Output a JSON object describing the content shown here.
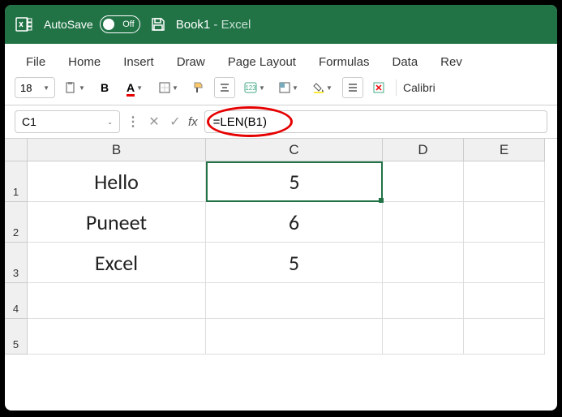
{
  "titlebar": {
    "autosave_label": "AutoSave",
    "autosave_state": "Off",
    "doc_name": "Book1",
    "app_suffix": " -  Excel"
  },
  "tabs": [
    "File",
    "Home",
    "Insert",
    "Draw",
    "Page Layout",
    "Formulas",
    "Data",
    "Rev"
  ],
  "toolbar": {
    "font_size": "18",
    "font_name": "Calibri"
  },
  "formula_bar": {
    "name_box": "C1",
    "formula": "=LEN(B1)"
  },
  "columns": [
    "B",
    "C",
    "D",
    "E"
  ],
  "rows": [
    "1",
    "2",
    "3",
    "4",
    "5"
  ],
  "cells": {
    "B1": "Hello",
    "C1": "5",
    "B2": "Puneet",
    "C2": "6",
    "B3": "Excel",
    "C3": "5"
  },
  "selected_cell": "C1"
}
